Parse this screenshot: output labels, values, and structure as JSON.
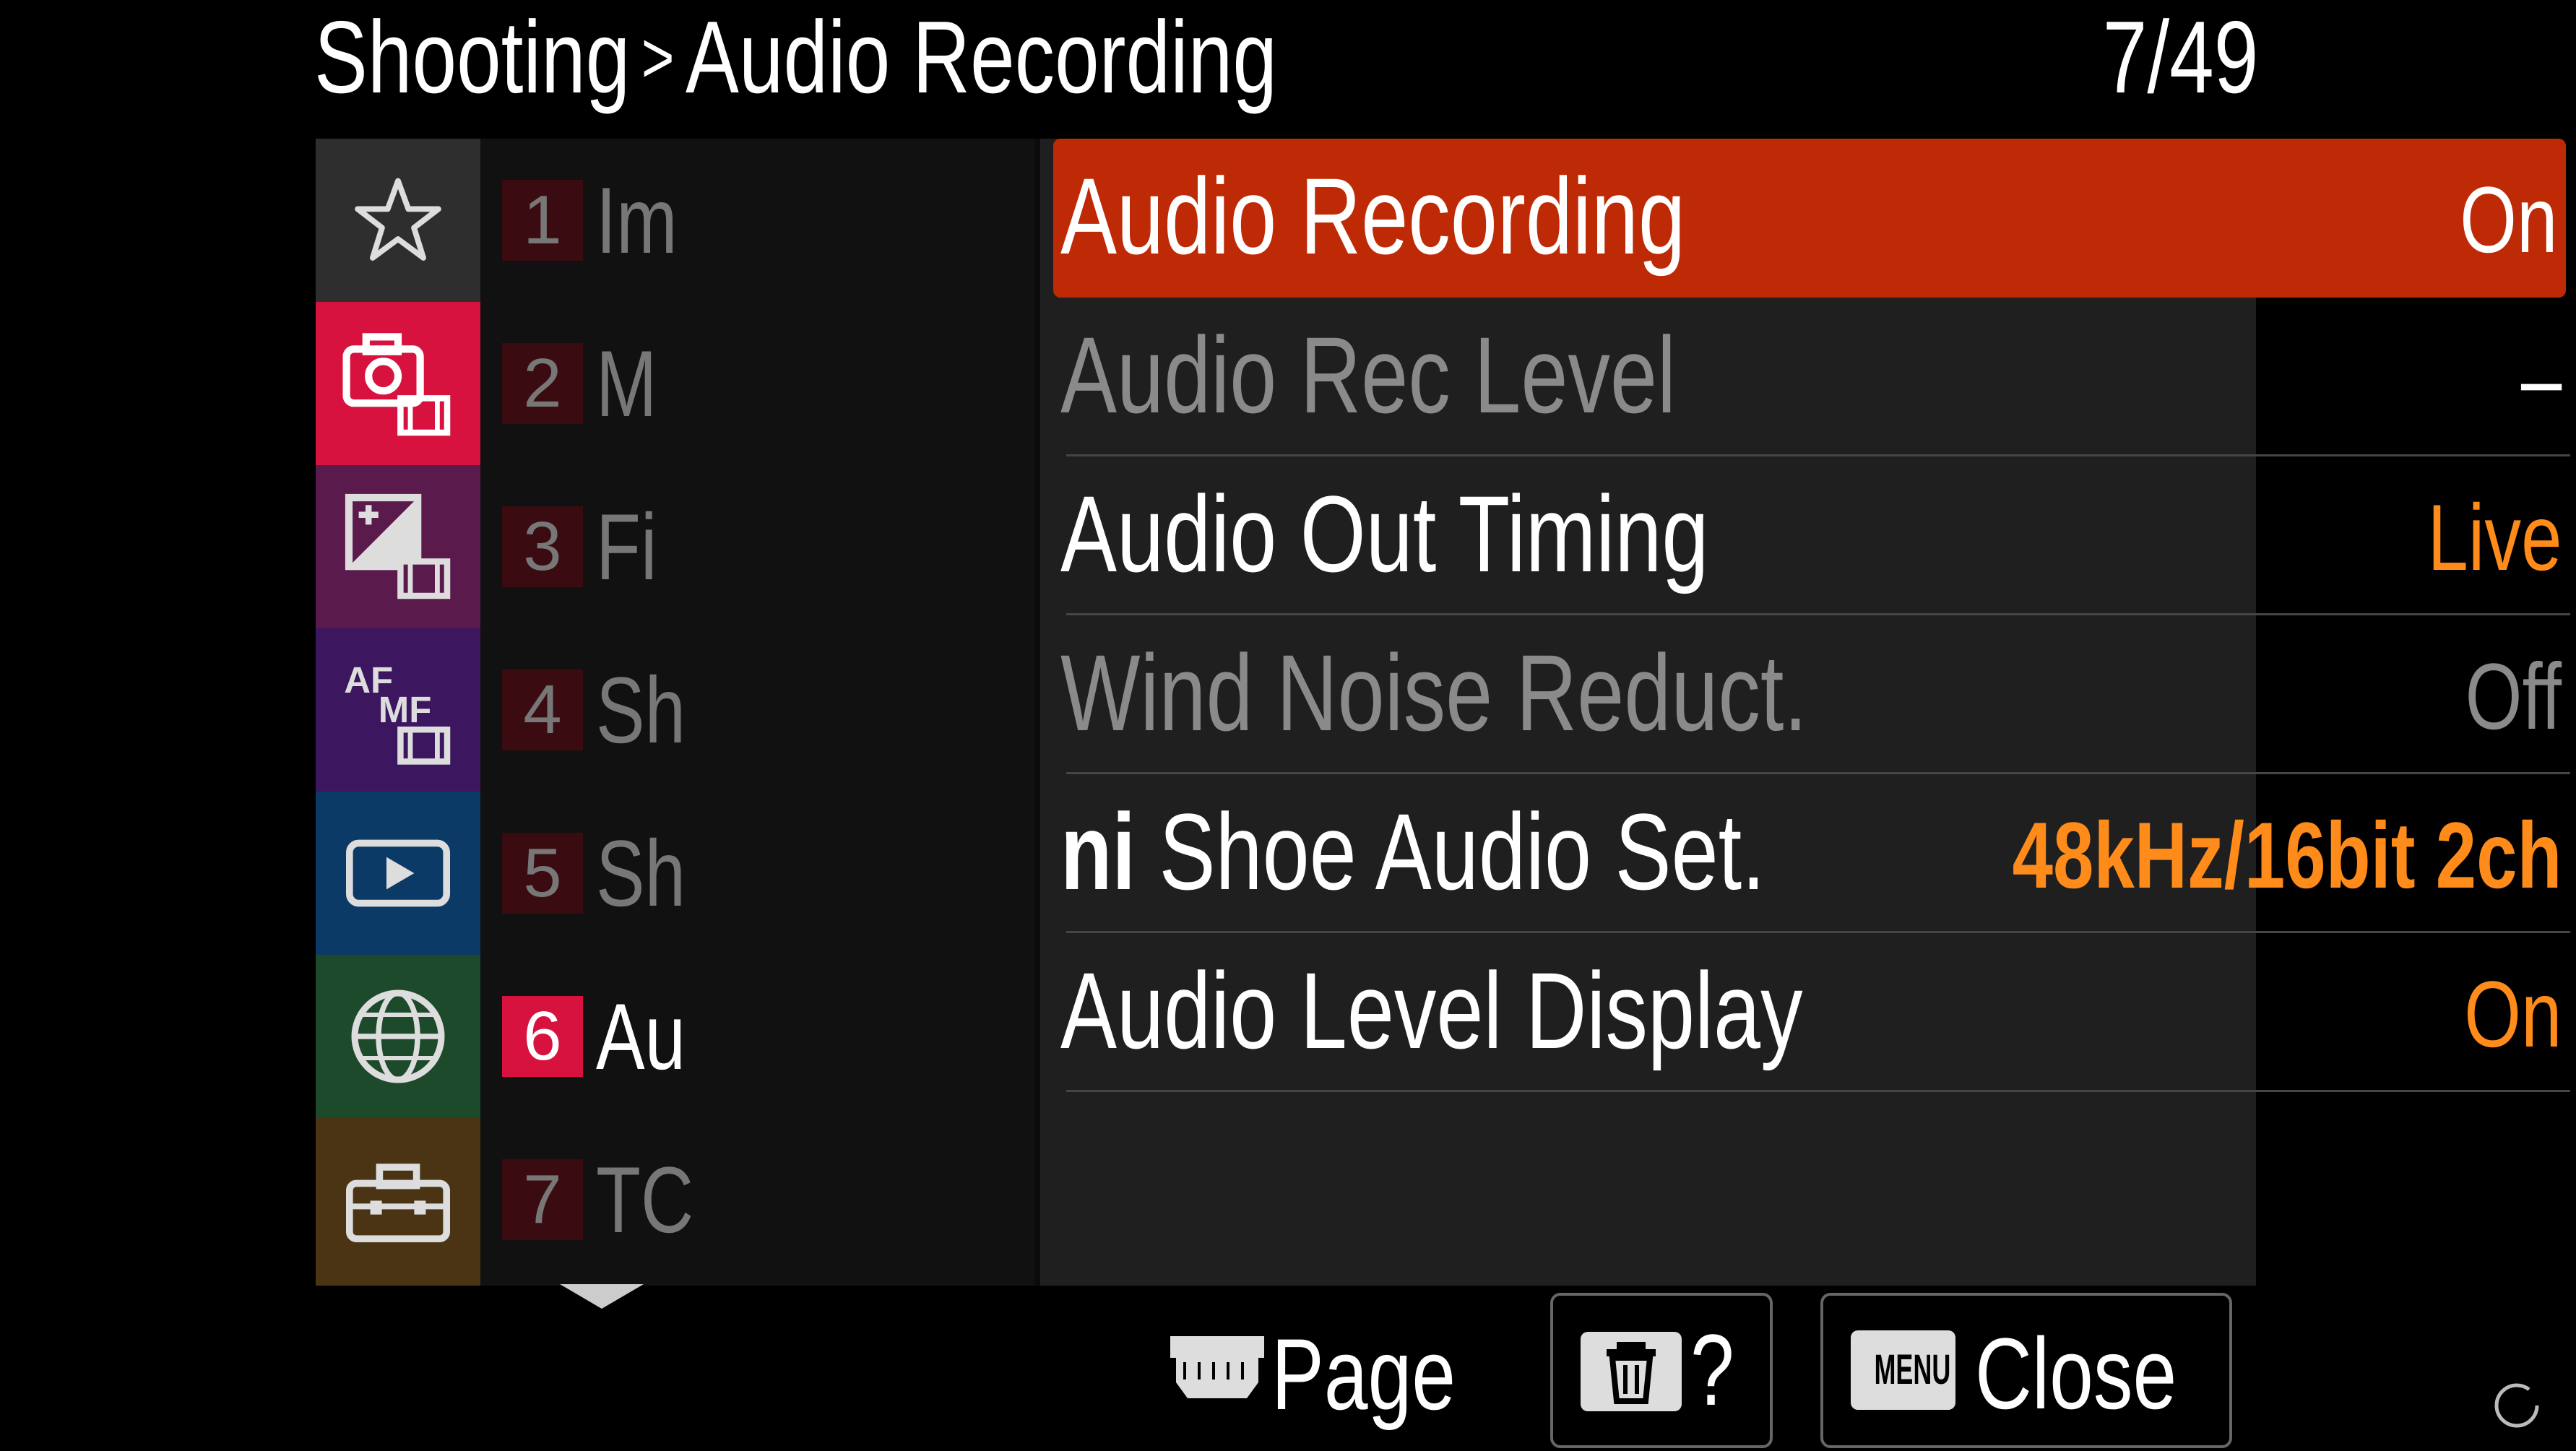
{
  "header": {
    "section": "Shooting",
    "separator": ">",
    "subsection": "Audio Recording",
    "page": "7/49"
  },
  "categories": [
    {
      "icon": "star-icon",
      "color": "#2e2e2e"
    },
    {
      "icon": "camera-movie-icon",
      "color": "#d8123e"
    },
    {
      "icon": "exposure-movie-icon",
      "color": "#5a1a4c"
    },
    {
      "icon": "af-mf-movie-icon",
      "color": "#3d1660"
    },
    {
      "icon": "playback-icon",
      "color": "#0c3a66"
    },
    {
      "icon": "globe-icon",
      "color": "#1d4a2a"
    },
    {
      "icon": "toolbox-icon",
      "color": "#4a3414"
    }
  ],
  "tabs": [
    {
      "num": "1",
      "text": "Im"
    },
    {
      "num": "2",
      "text": "M"
    },
    {
      "num": "3",
      "text": "Fi"
    },
    {
      "num": "4",
      "text": "Sh"
    },
    {
      "num": "5",
      "text": "Sh"
    },
    {
      "num": "6",
      "text": "Au"
    },
    {
      "num": "7",
      "text": "TC"
    }
  ],
  "items": [
    {
      "label": "Audio Recording",
      "value": "On"
    },
    {
      "label": "Audio Rec Level",
      "value": "–"
    },
    {
      "label": "Audio Out Timing",
      "value": "Live"
    },
    {
      "label": "Wind Noise Reduct.",
      "value": "Off"
    },
    {
      "prefix": "ni",
      "label": "Shoe Audio Set.",
      "value": "48kHz/16bit 2ch"
    },
    {
      "label": "Audio Level Display",
      "value": "On"
    }
  ],
  "footer": {
    "page_label": "Page",
    "help_label": "?",
    "menu_badge": "MENU",
    "close_label": "Close"
  },
  "colors": {
    "selected_row": "#bf2a06",
    "value_orange": "#ff8c1a",
    "active_tab": "#d8123e"
  }
}
